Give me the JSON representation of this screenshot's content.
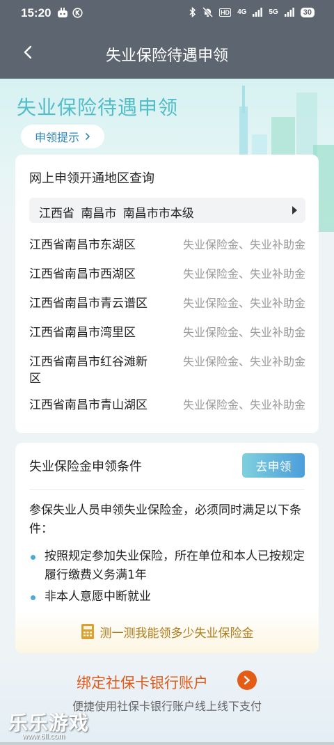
{
  "status_bar": {
    "time": "15:20",
    "network_1": "4G",
    "network_2": "5G",
    "hd": "HD",
    "battery": "30",
    "icons": [
      "app-icon",
      "k-badge-icon",
      "bluetooth-icon",
      "mute-icon",
      "signal-icon"
    ]
  },
  "nav": {
    "title": "失业保险待遇申领",
    "back_icon": "chevron-left-icon"
  },
  "hero": {
    "title": "失业保险待遇申领",
    "tips_label": "申领提示"
  },
  "region_query": {
    "title": "网上申领开通地区查询",
    "selected_region": "江西省 南昌市 南昌市市本级",
    "rows": [
      {
        "area": "江西省南昌市东湖区",
        "types": "失业保险金、失业补助金"
      },
      {
        "area": "江西省南昌市西湖区",
        "types": "失业保险金、失业补助金"
      },
      {
        "area": "江西省南昌市青云谱区",
        "types": "失业保险金、失业补助金"
      },
      {
        "area": "江西省南昌市湾里区",
        "types": "失业保险金、失业补助金"
      },
      {
        "area": "江西省南昌市红谷滩新区",
        "types": "失业保险金、失业补助金"
      },
      {
        "area": "江西省南昌市青山湖区",
        "types": "失业保险金、失业补助金"
      }
    ]
  },
  "conditions": {
    "title": "失业保险金申领条件",
    "apply_label": "去申领",
    "intro": "参保失业人员申领失业保险金，必须同时满足以下条件：",
    "bullets": [
      "按照规定参加失业保险，所在单位和本人已按规定履行缴费义务满1年",
      "非本人意愿中断就业"
    ],
    "calc_label": "测一测我能领多少失业保险金"
  },
  "promo": {
    "title": "绑定社保卡银行账户",
    "subtitle": "便捷使用社保卡银行账户线上线下支付",
    "watermark": "乐乐游戏",
    "watermark_url": "www.6ll.com"
  },
  "colors": {
    "header": "#5d6670",
    "accent": "#4fa9d6",
    "orange": "#e45d17"
  }
}
